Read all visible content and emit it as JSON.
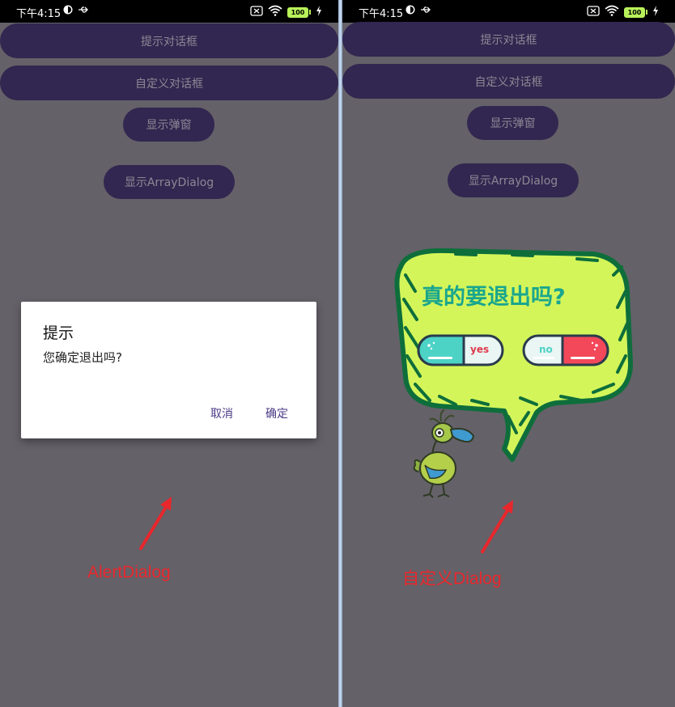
{
  "status": {
    "time": "下午4:15",
    "battery": "100"
  },
  "buttons": {
    "tip_dialog": "提示对话框",
    "custom_dialog": "自定义对话框",
    "show_popup": "显示弹窗",
    "show_array_dialog": "显示ArrayDialog"
  },
  "alert_dialog": {
    "title": "提示",
    "message": "您确定退出吗?",
    "cancel": "取消",
    "confirm": "确定"
  },
  "custom_dialog": {
    "title": "真的要退出吗?",
    "yes": "yes",
    "no": "no"
  },
  "captions": {
    "left": "AlertDialog",
    "right": "自定义Dialog"
  },
  "colors": {
    "accent_red": "#e8272c",
    "button_bg": "#312750",
    "bubble_fill": "#d4f55a",
    "bubble_border": "#0e6e3b",
    "title_green": "#19a68e"
  }
}
